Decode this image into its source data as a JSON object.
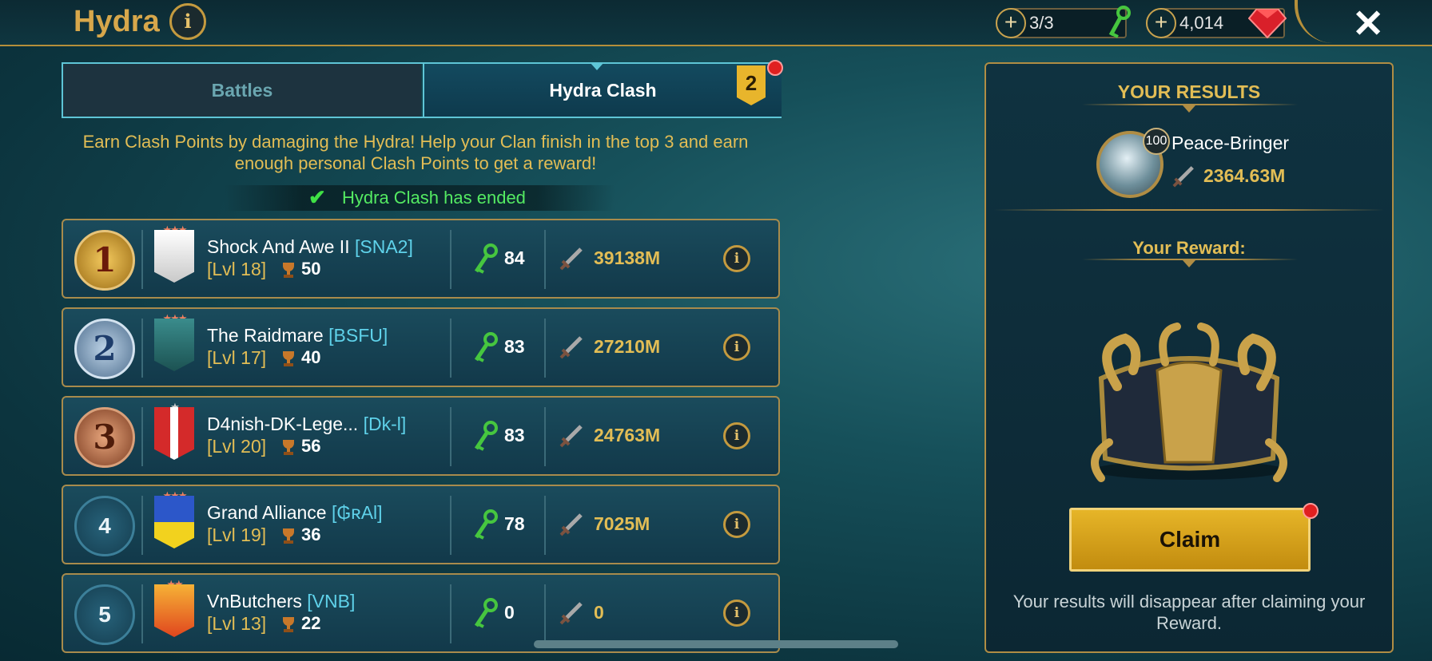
{
  "header": {
    "title": "Hydra",
    "keys_value": "3/3",
    "gems_value": "4,014",
    "plus_label": "+",
    "close_label": "✕",
    "info_label": "i"
  },
  "tabs": [
    {
      "label": "Battles",
      "active": false
    },
    {
      "label": "Hydra Clash",
      "active": true,
      "badge": "2"
    }
  ],
  "description": "Earn Clash Points by damaging the Hydra! Help your Clan finish in the top 3 and earn enough personal Clash Points to get a reward!",
  "status": {
    "icon": "✔",
    "text": "Hydra Clash has ended"
  },
  "clans": [
    {
      "rank": "1",
      "name": "Shock And Awe II",
      "tag": "[SNA2]",
      "level": "[Lvl 18]",
      "trophies": "50",
      "keys": "84",
      "damage": "39138M"
    },
    {
      "rank": "2",
      "name": "The Raidmare",
      "tag": "[BSFU]",
      "level": "[Lvl 17]",
      "trophies": "40",
      "keys": "83",
      "damage": "27210M"
    },
    {
      "rank": "3",
      "name": "D4nish-DK-Lege...",
      "tag": "[Dk-l]",
      "level": "[Lvl 20]",
      "trophies": "56",
      "keys": "83",
      "damage": "24763M"
    },
    {
      "rank": "4",
      "name": "Grand Alliance",
      "tag": "[₲ʀAl]",
      "level": "[Lvl 19]",
      "trophies": "36",
      "keys": "78",
      "damage": "7025M"
    },
    {
      "rank": "5",
      "name": "VnButchers",
      "tag": "[VNB]",
      "level": "[Lvl 13]",
      "trophies": "22",
      "keys": "0",
      "damage": "0"
    }
  ],
  "results": {
    "heading": "YOUR RESULTS",
    "champion_level": "100",
    "champion_name": "Peace-Bringer",
    "champion_damage": "2364.63M",
    "reward_heading": "Your Reward:",
    "claim_label": "Claim",
    "note": "Your results will disappear after claiming your Reward."
  },
  "colors": {
    "gold_text": "#e2bd55",
    "tag_cyan": "#5fd2ea",
    "success_green": "#54ea62",
    "claim_button": "#e6b528"
  },
  "icons": {
    "info": "info-icon",
    "keys": "hydra-key-icon",
    "damage": "sword-icon",
    "gem": "ruby-gem-icon",
    "trophy": "trophy-icon",
    "close": "close-icon"
  }
}
